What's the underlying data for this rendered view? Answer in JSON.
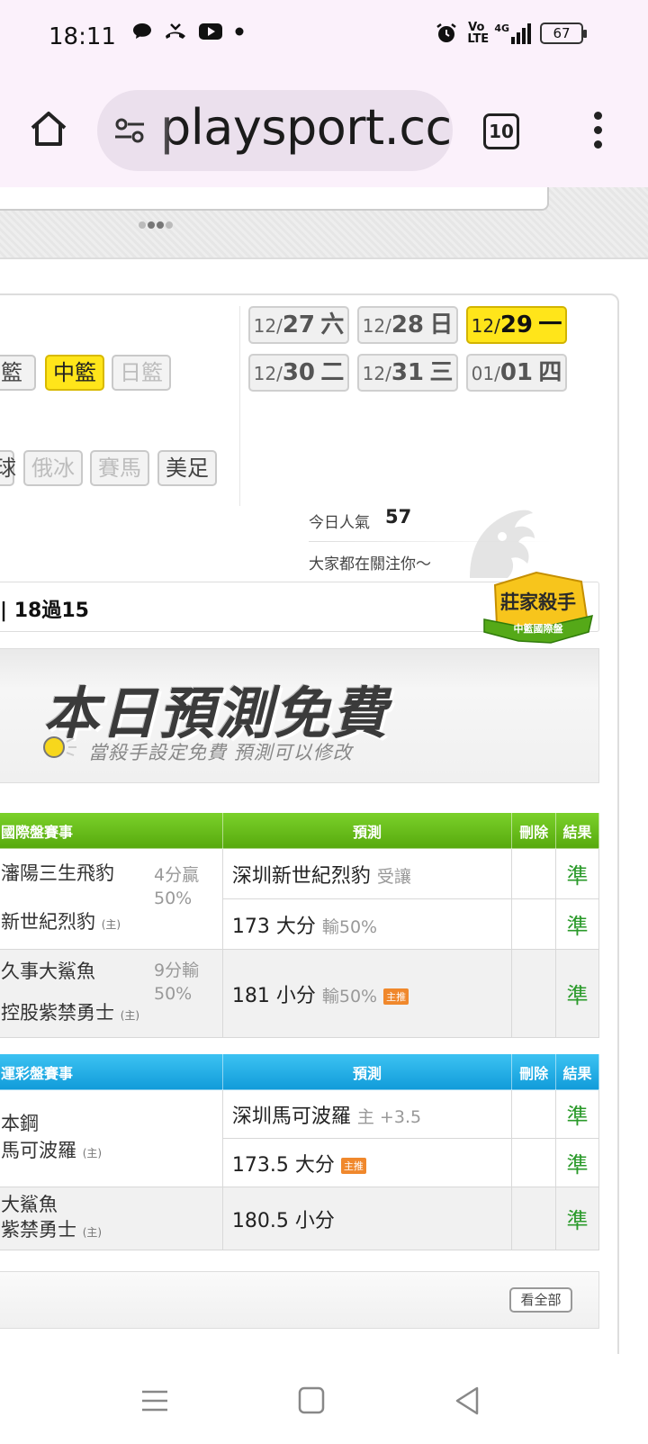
{
  "status": {
    "time": "18:11",
    "volte": "Vo LTE",
    "network": "4G",
    "battery": "67"
  },
  "browser": {
    "url": "playsport.cc",
    "tab_count": "10"
  },
  "sports": {
    "row1": [
      "籃",
      "中籃",
      "日籃"
    ],
    "row2": [
      "球",
      "俄冰",
      "賽馬",
      "美足"
    ],
    "active": "中籃"
  },
  "dates": [
    {
      "md": "12/",
      "d": "27",
      "w": "六",
      "active": false
    },
    {
      "md": "12/",
      "d": "28",
      "w": "日",
      "active": false
    },
    {
      "md": "12/",
      "d": "29",
      "w": "一",
      "active": true
    },
    {
      "md": "12/",
      "d": "30",
      "w": "二",
      "active": false
    },
    {
      "md": "12/",
      "d": "31",
      "w": "三",
      "active": false
    },
    {
      "md": "01/",
      "d": "01",
      "w": "四",
      "active": false
    }
  ],
  "popularity": {
    "label": "今日人氣",
    "value": "57",
    "subtitle": "大家都在關注你～"
  },
  "record": {
    "text": "18過15",
    "badge_title": "莊家殺手",
    "badge_sub": "中籃國際盤"
  },
  "free_banner": {
    "title": "本日預測免費",
    "subtitle": "當殺手設定免費 預測可以修改"
  },
  "intl_table": {
    "headers": [
      "國際盤賽事",
      "預測",
      "刪除",
      "結果"
    ],
    "games": [
      {
        "team1": "瀋陽三生飛豹",
        "team2": "新世紀烈豹",
        "host_mark": "(主)",
        "score1": "4分贏",
        "score2": "50%",
        "preds": [
          {
            "main": "深圳新世紀烈豹",
            "extra": "受讓",
            "tag": "",
            "result": "準"
          },
          {
            "main": "173 大分",
            "extra": "輸50%",
            "tag": "",
            "result": "準"
          }
        ]
      },
      {
        "team1": "久事大鯊魚",
        "team2": "控股紫禁勇士",
        "host_mark": "(主)",
        "score1": "9分輸",
        "score2": "50%",
        "preds": [
          {
            "main": "181 小分",
            "extra": "輸50%",
            "tag": "主推",
            "result": "準"
          }
        ]
      }
    ]
  },
  "lottery_table": {
    "headers": [
      "運彩盤賽事",
      "預測",
      "刪除",
      "結果"
    ],
    "games": [
      {
        "team1": "本鋼",
        "team2": "馬可波羅",
        "host_mark": "(主)",
        "preds": [
          {
            "main": "深圳馬可波羅",
            "extra": "主 +3.5",
            "tag": "",
            "result": "準"
          },
          {
            "main": "173.5 大分",
            "extra": "",
            "tag": "主推",
            "result": "準"
          }
        ]
      },
      {
        "team1": "大鯊魚",
        "team2": "紫禁勇士",
        "host_mark": "(主)",
        "preds": [
          {
            "main": "180.5 小分",
            "extra": "",
            "tag": "",
            "result": "準"
          }
        ]
      }
    ]
  },
  "more_button": "看全部"
}
